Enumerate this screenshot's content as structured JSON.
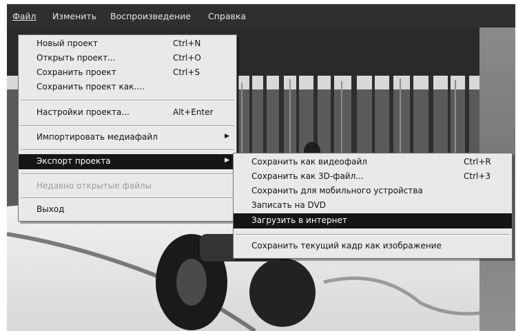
{
  "menubar": {
    "items": [
      "Файл",
      "Изменить",
      "Воспроизведение",
      "Справка"
    ]
  },
  "file_menu": {
    "items": [
      {
        "label": "Новый проект",
        "shortcut": "Ctrl+N"
      },
      {
        "label": "Открыть проект...",
        "shortcut": "Ctrl+O"
      },
      {
        "label": "Сохранить проект",
        "shortcut": "Ctrl+S"
      },
      {
        "label": "Сохранить проект как...."
      },
      {
        "label": "Настройки проекта...",
        "shortcut": "Alt+Enter"
      },
      {
        "label": "Импортировать медиафайл"
      },
      {
        "label": "Экспорт проекта"
      },
      {
        "label": "Недавно открытые файлы"
      },
      {
        "label": "Выход"
      }
    ]
  },
  "export_submenu": {
    "items": [
      {
        "label": "Сохранить как видеофайл",
        "shortcut": "Ctrl+R"
      },
      {
        "label": "Сохранить как 3D-файл...",
        "shortcut": "Ctrl+3"
      },
      {
        "label": "Сохранить для мобильного устройства"
      },
      {
        "label": "Записать на DVD"
      },
      {
        "label": "Загрузить в интернет"
      },
      {
        "label": "Сохранить текущий кадр как изображение"
      }
    ]
  },
  "colors": {
    "menu_bg": "#e9e9e9",
    "highlight": "#161616",
    "menubar_bg": "#2f2f2f",
    "disabled_text": "#9a9a9a"
  }
}
